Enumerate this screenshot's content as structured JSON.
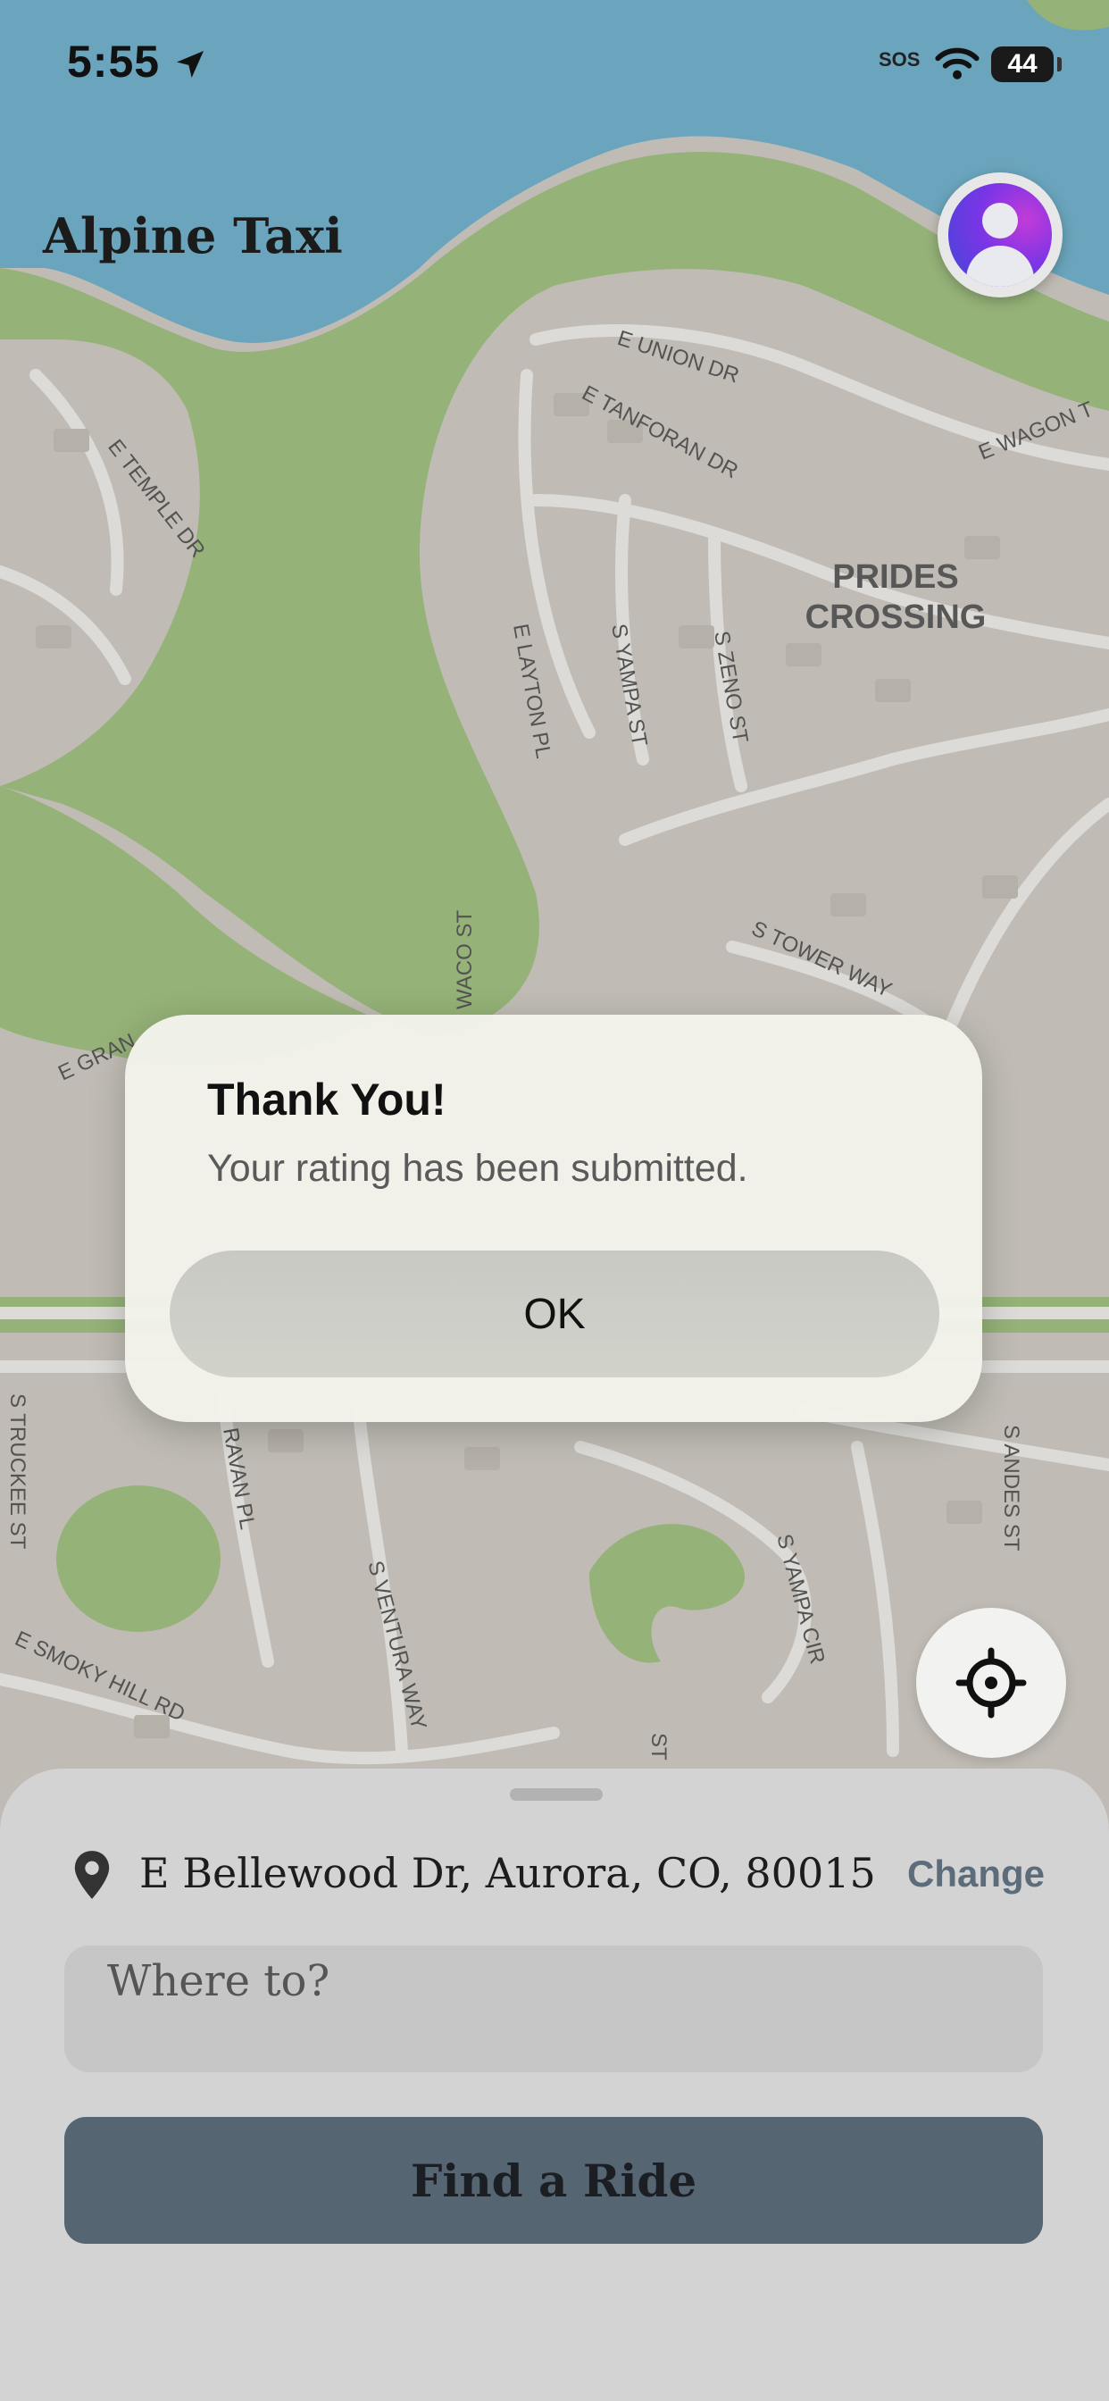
{
  "status_bar": {
    "time": "5:55",
    "sos": "SOS",
    "battery": "44"
  },
  "app": {
    "title": "Alpine Taxi"
  },
  "map": {
    "labels": [
      "E UNION DR",
      "E TANFORAN DR",
      "E WAGON T",
      "E TEMPLE DR",
      "PRIDES",
      "CROSSING",
      "E LAYTON PL",
      "S YAMPA ST",
      "S ZENO ST",
      "S TOWER WAY",
      "WACO ST",
      "E GRAN",
      "S TRUCKEE ST",
      "RAVAN PL",
      "S VENTURA WAY",
      "S YAMPA CIR",
      "S ANDES ST",
      "E SMOKY HILL RD",
      "ST"
    ]
  },
  "dialog": {
    "title": "Thank You!",
    "message": "Your rating has been submitted.",
    "ok_label": "OK"
  },
  "sheet": {
    "pickup_address": "E Bellewood Dr, Aurora, CO, 80015",
    "change_label": "Change",
    "destination_placeholder": "Where to?",
    "find_ride_label": "Find a Ride"
  },
  "colors": {
    "map_land": "#cfcac2",
    "map_water": "#6fb0cb",
    "map_park": "#9fbf7e",
    "primary_button": "#566572",
    "link": "#5d6c7b"
  }
}
